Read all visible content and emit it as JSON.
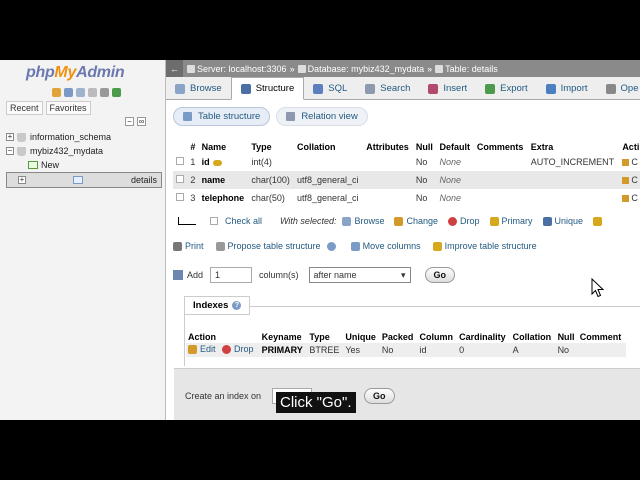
{
  "nav": {
    "logo": {
      "php": "php",
      "my": "My",
      "admin": "Admin"
    },
    "tabs": [
      "Recent",
      "Favorites"
    ],
    "tree": [
      {
        "label": "information_schema",
        "expander": "+",
        "type": "db"
      },
      {
        "label": "mybiz432_mydata",
        "expander": "−",
        "type": "db"
      },
      {
        "label": "New",
        "expander": "",
        "type": "new"
      },
      {
        "label": "details",
        "expander": "+",
        "type": "table",
        "selected": true
      }
    ]
  },
  "breadcrumb": {
    "server": "Server: localhost:3306",
    "database": "Database: mybiz432_mydata",
    "table": "Table: details",
    "sep": "»"
  },
  "tabs": [
    {
      "label": "Browse",
      "color": "#8aa4c8"
    },
    {
      "label": "Structure",
      "color": "#4a6fa5",
      "active": true
    },
    {
      "label": "SQL",
      "color": "#5b7fbf"
    },
    {
      "label": "Search",
      "color": "#8d99ae"
    },
    {
      "label": "Insert",
      "color": "#b14b6b"
    },
    {
      "label": "Export",
      "color": "#4c9a4c"
    },
    {
      "label": "Import",
      "color": "#4c7fbf"
    },
    {
      "label": "Ope",
      "color": "#888"
    }
  ],
  "subtabs": [
    {
      "label": "Table structure"
    },
    {
      "label": "Relation view"
    }
  ],
  "structure": {
    "headers": [
      "#",
      "Name",
      "Type",
      "Collation",
      "Attributes",
      "Null",
      "Default",
      "Comments",
      "Extra",
      "Acti"
    ],
    "rows": [
      {
        "num": "1",
        "name": "id",
        "type": "int(4)",
        "collation": "",
        "attributes": "",
        "null": "No",
        "default": "None",
        "comments": "",
        "extra": "AUTO_INCREMENT",
        "action": "C",
        "key": true
      },
      {
        "num": "2",
        "name": "name",
        "type": "char(100)",
        "collation": "utf8_general_ci",
        "attributes": "",
        "null": "No",
        "default": "None",
        "comments": "",
        "extra": "",
        "action": "C",
        "key": false
      },
      {
        "num": "3",
        "name": "telephone",
        "type": "char(50)",
        "collation": "utf8_general_ci",
        "attributes": "",
        "null": "No",
        "default": "None",
        "comments": "",
        "extra": "",
        "action": "C",
        "key": false
      }
    ]
  },
  "with_selected": {
    "check_all": "Check all",
    "label": "With selected:",
    "actions": [
      "Browse",
      "Change",
      "Drop",
      "Primary",
      "Unique"
    ]
  },
  "tools": [
    "Print",
    "Propose table structure",
    "Move columns",
    "Improve table structure"
  ],
  "add_columns": {
    "label": "Add",
    "value": "1",
    "unit": "column(s)",
    "position": "after name",
    "go": "Go"
  },
  "indexes": {
    "legend": "Indexes",
    "help": "?",
    "headers": [
      "Action",
      "Keyname",
      "Type",
      "Unique",
      "Packed",
      "Column",
      "Cardinality",
      "Collation",
      "Null",
      "Comment"
    ],
    "rows": [
      {
        "edit": "Edit",
        "drop": "Drop",
        "keyname": "PRIMARY",
        "type": "BTREE",
        "unique": "Yes",
        "packed": "No",
        "column": "id",
        "cardinality": "0",
        "collation": "A",
        "null": "No",
        "comment": ""
      }
    ]
  },
  "create_index": {
    "label": "Create an index on",
    "go": "Go"
  },
  "caption": "Click \"Go\"."
}
